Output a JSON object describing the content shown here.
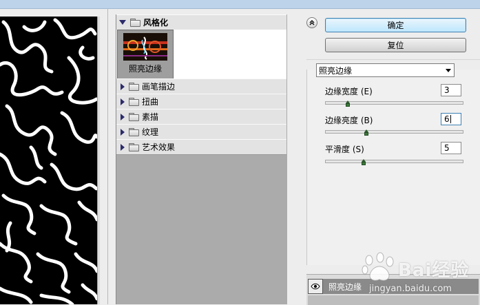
{
  "gallery": {
    "expanded_category": "风格化",
    "thumbnail_label": "照亮边缘",
    "categories": [
      "画笔描边",
      "扭曲",
      "素描",
      "纹理",
      "艺术效果"
    ]
  },
  "buttons": {
    "ok": "确定",
    "reset": "复位"
  },
  "settings": {
    "filter_select": "照亮边缘",
    "params": [
      {
        "label": "边缘宽度 (E)",
        "value": "3",
        "level": 0.16
      },
      {
        "label": "边缘亮度 (B)",
        "value": "6",
        "level": 0.3
      },
      {
        "label": "平滑度 (S)",
        "value": "5",
        "level": 0.28
      }
    ]
  },
  "layers": {
    "active_layer": "照亮边缘"
  },
  "watermark": {
    "brand": "Bai经验",
    "url": "jingyan.baidu.com"
  },
  "colors": {
    "accent": "#3c7fb1",
    "slider_knob": "#3d7a3d",
    "gallery_bg": "#ababab"
  }
}
